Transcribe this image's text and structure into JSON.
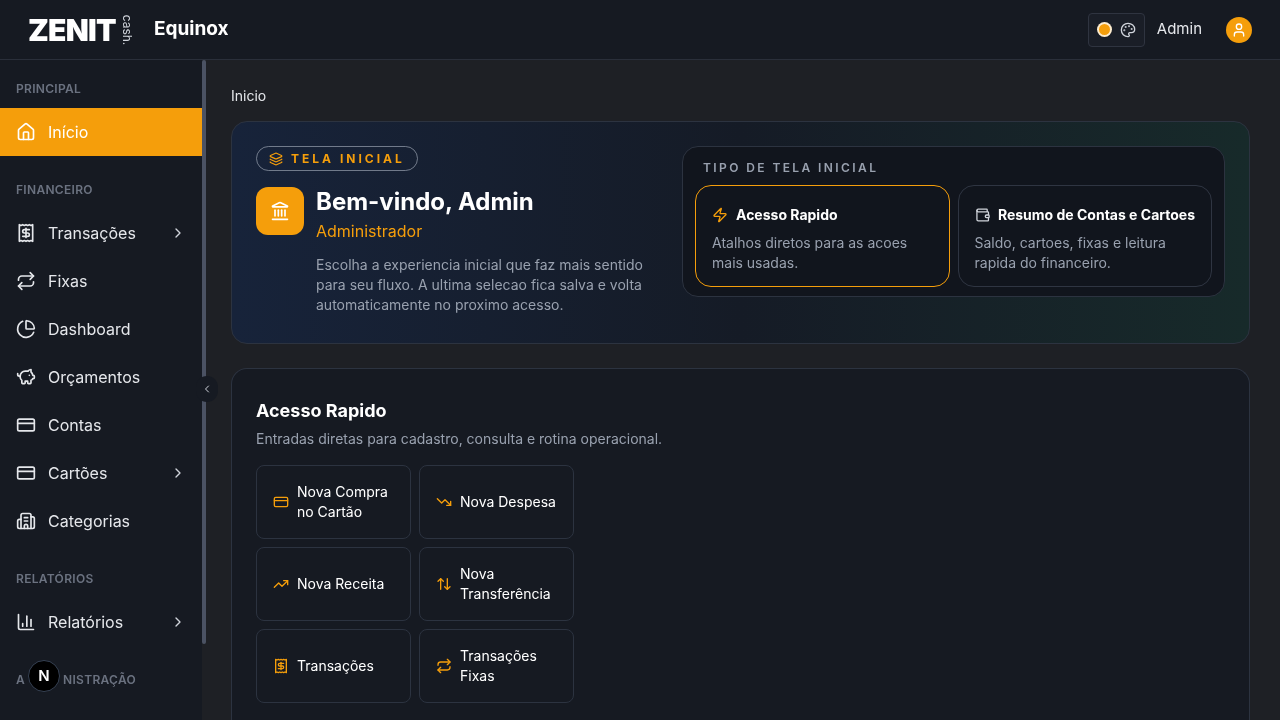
{
  "header": {
    "logo": "ZENIT",
    "logo_sub": "cash.",
    "app_name": "Equinox",
    "user": "Admin"
  },
  "sidebar": {
    "sections": [
      {
        "title": "PRINCIPAL",
        "items": [
          {
            "label": "Início",
            "kind": "home",
            "selected": true,
            "has_submenu": false
          }
        ]
      },
      {
        "title": "FINANCEIRO",
        "items": [
          {
            "label": "Transações",
            "kind": "receipt",
            "selected": false,
            "has_submenu": true
          },
          {
            "label": "Fixas",
            "kind": "repeat",
            "selected": false,
            "has_submenu": false
          },
          {
            "label": "Dashboard",
            "kind": "pie",
            "selected": false,
            "has_submenu": false
          },
          {
            "label": "Orçamentos",
            "kind": "piggy",
            "selected": false,
            "has_submenu": false
          },
          {
            "label": "Contas",
            "kind": "card",
            "selected": false,
            "has_submenu": false
          },
          {
            "label": "Cartões",
            "kind": "card",
            "selected": false,
            "has_submenu": true
          },
          {
            "label": "Categorias",
            "kind": "building",
            "selected": false,
            "has_submenu": false
          }
        ]
      },
      {
        "title": "RELATÓRIOS",
        "items": [
          {
            "label": "Relatórios",
            "kind": "chart",
            "selected": false,
            "has_submenu": true
          }
        ]
      }
    ],
    "last_section_title_parts": [
      "A",
      "NISTRAÇÃO"
    ]
  },
  "breadcrumb": "Inicio",
  "hero": {
    "badge": "TELA INICIAL",
    "title": "Bem-vindo, Admin",
    "role": "Administrador",
    "description": "Escolha a experiencia inicial que faz mais sentido para seu fluxo. A ultima selecao fica salva e volta automaticamente no proximo acesso.",
    "picker": {
      "title": "TIPO DE TELA INICIAL",
      "options": [
        {
          "kind": "zap",
          "title": "Acesso Rapido",
          "description": "Atalhos diretos para as acoes mais usadas.",
          "selected": true
        },
        {
          "kind": "wallet",
          "title": "Resumo de Contas e Cartoes",
          "description": "Saldo, cartoes, fixas e leitura rapida do financeiro.",
          "selected": false
        }
      ]
    }
  },
  "quick_access": {
    "title": "Acesso Rapido",
    "subtitle": "Entradas diretas para cadastro, consulta e rotina operacional.",
    "actions": [
      {
        "kind": "card",
        "label": "Nova Compra no Cartão"
      },
      {
        "kind": "down",
        "label": "Nova Despesa"
      },
      {
        "kind": "up",
        "label": "Nova Receita"
      },
      {
        "kind": "updown",
        "label": "Nova Transferência"
      },
      {
        "kind": "receipt",
        "label": "Transações"
      },
      {
        "kind": "repeat",
        "label": "Transações Fixas"
      }
    ]
  },
  "dev_badge": "N"
}
